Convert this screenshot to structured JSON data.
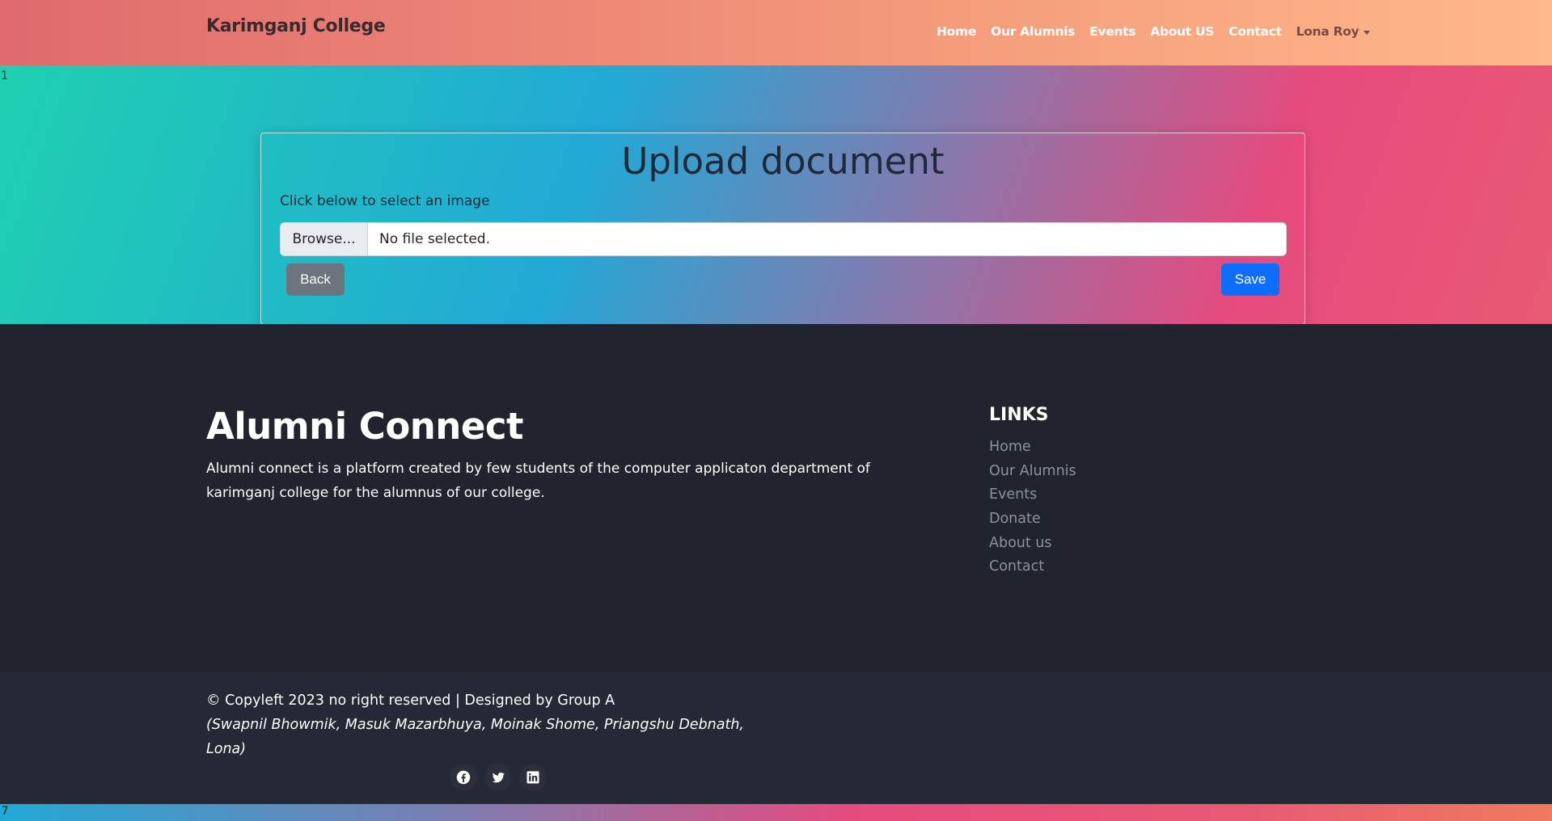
{
  "navbar": {
    "brand": "Karimganj College",
    "links": [
      "Home",
      "Our Alumnis",
      "Events",
      "About US",
      "Contact"
    ],
    "user": "Lona Roy"
  },
  "stray_text_top": "1",
  "stray_text_bottom": "7",
  "upload": {
    "title": "Upload document",
    "label": "Click below to select an image",
    "browse_label": "Browse...",
    "file_status": "No file selected.",
    "back_label": "Back",
    "save_label": "Save"
  },
  "footer": {
    "title": "Alumni Connect",
    "description": "Alumni connect is a platform created by few students of the computer applicaton department of karimganj college for the alumnus of our college.",
    "links_title": "LINKS",
    "links": [
      "Home",
      "Our Alumnis",
      "Events",
      "Donate",
      "About us",
      "Contact"
    ],
    "copyright": "© Copyleft 2023 no right reserved | Designed by Group A",
    "credits": "(Swapnil Bhowmik, Masuk Mazarbhuya, Moinak Shome, Priangshu Debnath, Lona)",
    "social_icons": [
      "facebook-icon",
      "twitter-icon",
      "linkedin-icon"
    ]
  },
  "colors": {
    "save_button": "#0d6efd",
    "back_button": "#6c757d",
    "footer_bg": "#21242f"
  }
}
